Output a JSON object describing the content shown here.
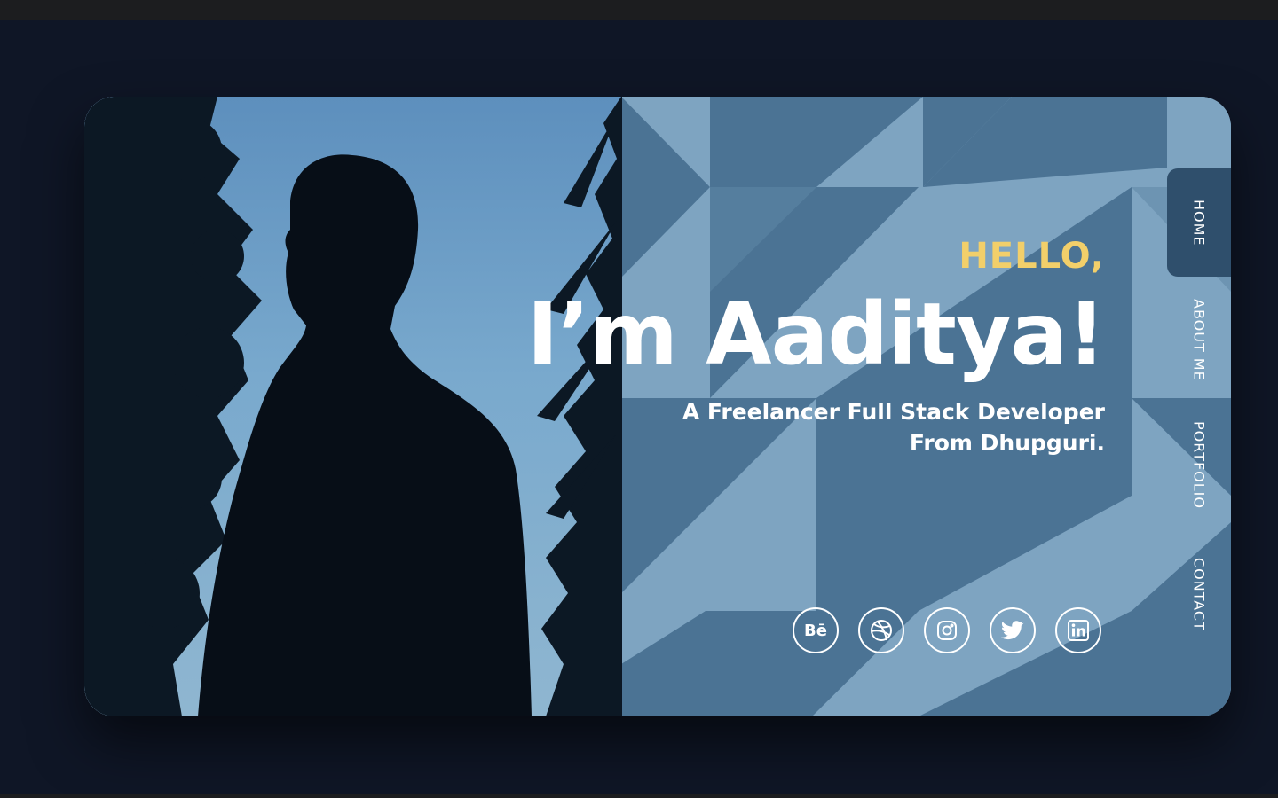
{
  "hero": {
    "greeting": "HELLO,",
    "name": "I’m Aaditya!",
    "tagline_line1": "A Freelancer Full Stack Developer",
    "tagline_line2": "From Dhupguri."
  },
  "nav": {
    "items": [
      {
        "label": "HOME",
        "active": true
      },
      {
        "label": "ABOUT ME",
        "active": false
      },
      {
        "label": "PORTFOLIO",
        "active": false
      },
      {
        "label": "CONTACT",
        "active": false
      }
    ]
  },
  "socials": [
    {
      "label": "Bē",
      "icon": "behance-icon"
    },
    {
      "icon": "dribbble-icon"
    },
    {
      "icon": "instagram-icon"
    },
    {
      "icon": "twitter-icon"
    },
    {
      "icon": "linkedin-icon"
    }
  ],
  "colors": {
    "page_bg": "#0f1626",
    "card_light": "#7ea4c1",
    "card_dark": "#4b7394",
    "greeting": "#f2cf6a",
    "nav_active": "#2f4f6c"
  }
}
